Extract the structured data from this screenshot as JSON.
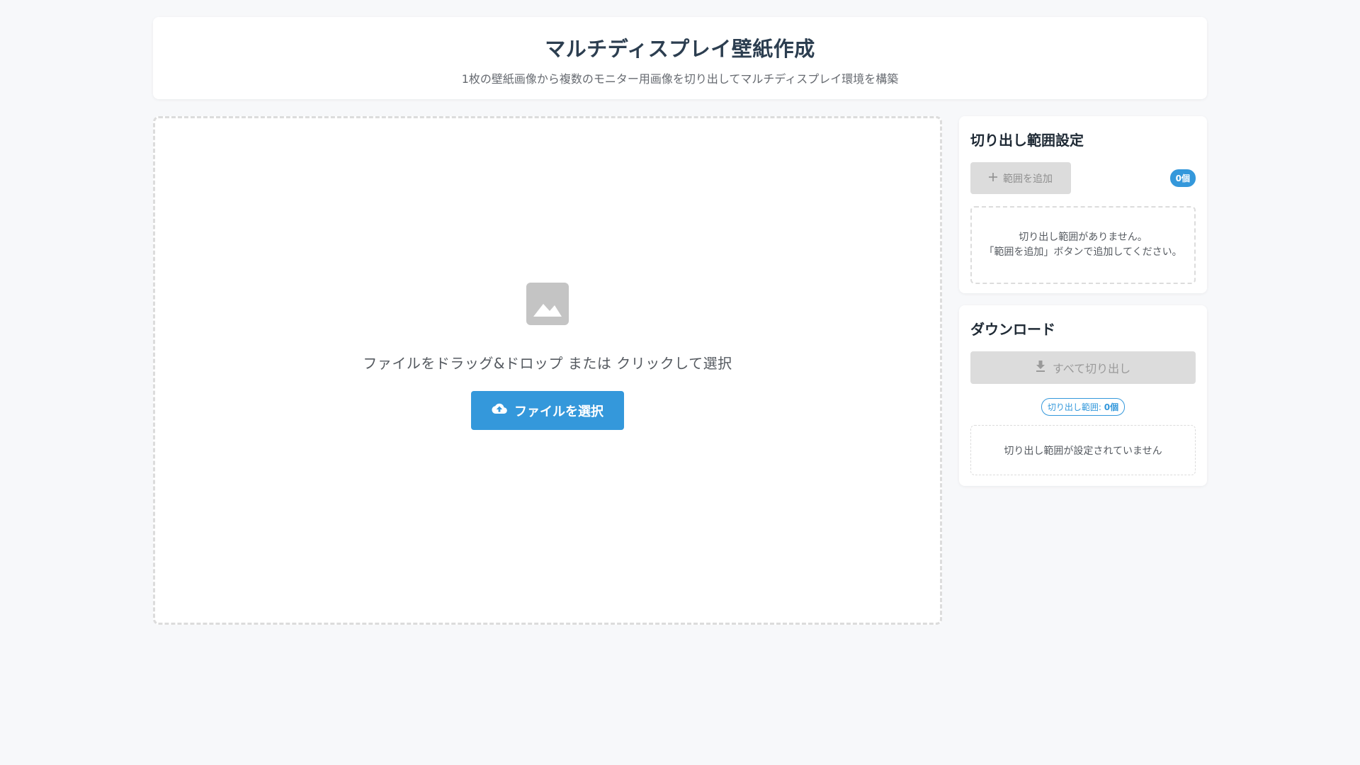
{
  "header": {
    "title": "マルチディスプレイ壁紙作成",
    "subtitle": "1枚の壁紙画像から複数のモニター用画像を切り出してマルチディスプレイ環境を構築"
  },
  "dropzone": {
    "icon": "image-icon",
    "text": "ファイルをドラッグ&ドロップ または クリックして選択",
    "button_label": "ファイルを選択",
    "button_icon": "cloud-upload-icon"
  },
  "range_panel": {
    "title": "切り出し範囲設定",
    "add_button_label": "範囲を追加",
    "add_button_icon": "plus-icon",
    "count_badge": "0個",
    "empty_line1": "切り出し範囲がありません。",
    "empty_line2": "「範囲を追加」ボタンで追加してください。"
  },
  "download_panel": {
    "title": "ダウンロード",
    "cut_all_label": "すべて切り出し",
    "cut_all_icon": "download-icon",
    "range_count_label": "切り出し範囲: ",
    "range_count_value": "0個",
    "status_text": "切り出し範囲が設定されていません"
  },
  "colors": {
    "accent": "#3498db",
    "disabled": "#dcdcdc",
    "background": "#f7f8fa"
  }
}
